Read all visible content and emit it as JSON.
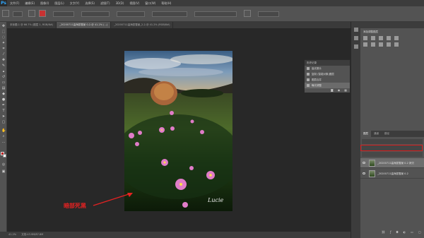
{
  "app": {
    "logo": "Ps"
  },
  "menu": [
    "文件(F)",
    "编辑(E)",
    "图像(I)",
    "图层(L)",
    "文字(Y)",
    "选择(S)",
    "滤镜(T)",
    "3D(D)",
    "视图(V)",
    "窗口(W)",
    "帮助(H)"
  ],
  "tabs": [
    {
      "label": "未标题-1 @ 66.7% (图层 1, RGB/8#)",
      "active": false
    },
    {
      "label": "_20200711高海拔雪景 0-2-@ 41.2% (...)",
      "active": true
    },
    {
      "label": "_20200711高海拔雪景_2-2-@ 41.2% (RGB/8#)",
      "active": false
    }
  ],
  "history": {
    "title": "历史记录",
    "items": [
      "高光原片",
      "复制 (智能对象)图层",
      "图层合并",
      "曝光调整"
    ],
    "selected": 3
  },
  "adjustments": {
    "title": "添加调整图层"
  },
  "layers": {
    "tabs": [
      "图层",
      "通道",
      "路径"
    ],
    "rows": [
      {
        "name": "_20200711高海拔雪景 0-2 拷贝",
        "selected": true
      },
      {
        "name": "_20200711高海拔雪景 0-2",
        "selected": false
      }
    ]
  },
  "status": {
    "zoom": "41.2%",
    "doc": "文档:43.9M/87.8M"
  },
  "annotation": {
    "text": "暗部死黑",
    "color": "#e52222"
  },
  "photo": {
    "signature": "Lucie"
  },
  "colors": {
    "accent": "#31a8ff",
    "annotation": "#e52222",
    "highlight_box": "#d61e1e"
  }
}
